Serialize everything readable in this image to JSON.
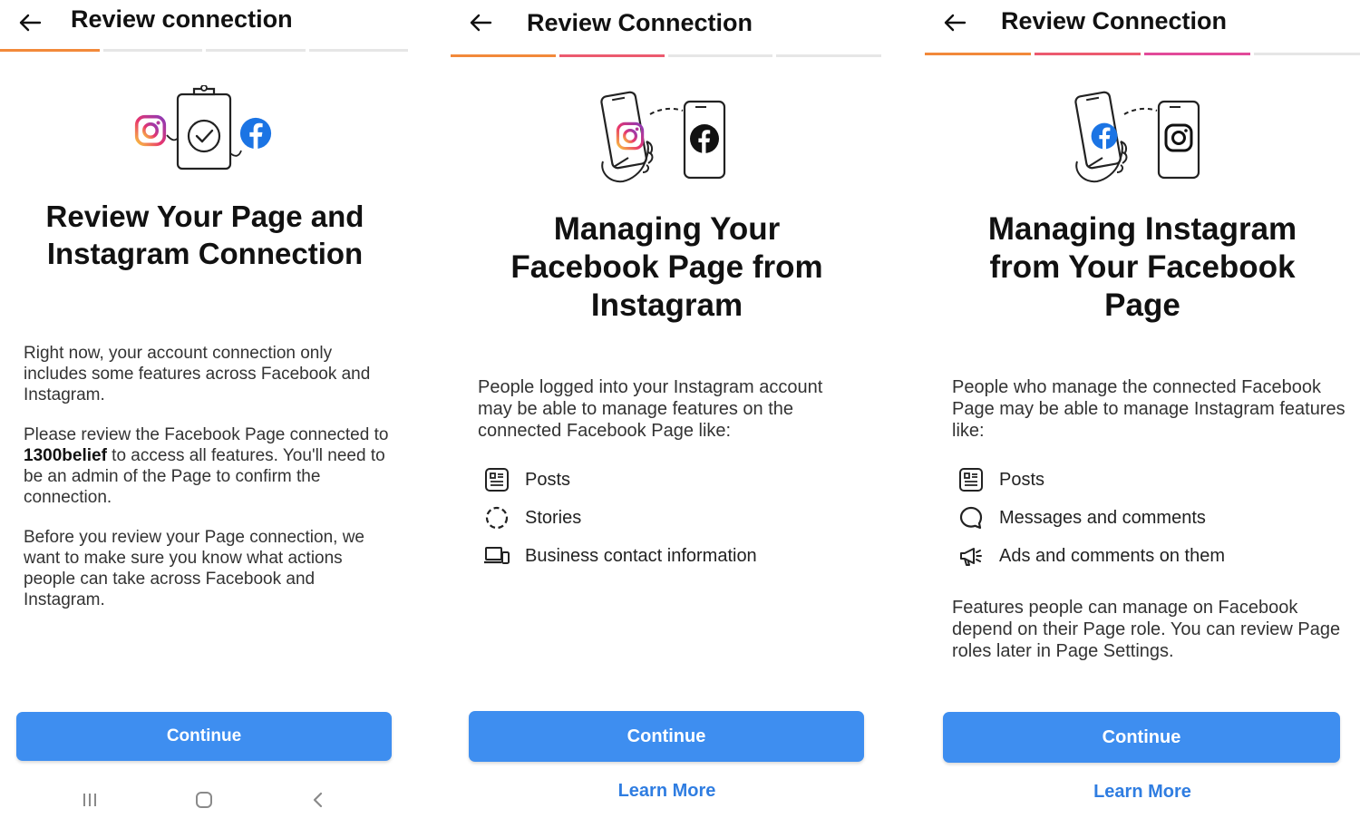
{
  "colors": {
    "accent": "#3e8ef0",
    "link": "#2f7de1",
    "progress_orange": "#f2893a",
    "progress_red": "#ec5a6f",
    "progress_pink": "#e24a9a",
    "progress_gray": "#e6e6e6"
  },
  "panel1": {
    "title": "Review connection",
    "back_icon": "arrow-left-icon",
    "progress_filled": 1,
    "progress_total": 4,
    "heading_line1": "Review Your Page and",
    "heading_line2": "Instagram Connection",
    "para1": "Right now, your account connection only includes some features across Facebook and Instagram.",
    "para2_before": "Please review the Facebook Page connected to ",
    "para2_account": "1300belief",
    "para2_after": " to access all features. You'll need to be an admin of the Page to confirm the connection.",
    "para3": "Before you review your Page connection, we want to make sure you know what actions people can take across Facebook and Instagram.",
    "continue": "Continue",
    "nav_icons": [
      "recent-apps-icon",
      "home-icon",
      "back-chevron-icon"
    ]
  },
  "panel2": {
    "title": "Review Connection",
    "back_icon": "arrow-left-icon",
    "progress_filled": 2,
    "progress_total": 4,
    "heading_line1": "Managing Your",
    "heading_line2": "Facebook Page from",
    "heading_line3": "Instagram",
    "para": "People logged into your Instagram account may be able to manage features on the connected Facebook Page like:",
    "features": [
      {
        "icon": "posts-icon",
        "label": "Posts"
      },
      {
        "icon": "stories-icon",
        "label": "Stories"
      },
      {
        "icon": "contact-info-icon",
        "label": "Business contact information"
      }
    ],
    "continue": "Continue",
    "learn_more": "Learn More"
  },
  "panel3": {
    "title": "Review Connection",
    "back_icon": "arrow-left-icon",
    "progress_filled": 3,
    "progress_total": 4,
    "heading_line1": "Managing Instagram",
    "heading_line2": "from Your Facebook",
    "heading_line3": "Page",
    "para": "People who manage the connected Facebook Page may be able to manage Instagram features like:",
    "features": [
      {
        "icon": "posts-icon",
        "label": "Posts"
      },
      {
        "icon": "messages-icon",
        "label": "Messages and comments"
      },
      {
        "icon": "megaphone-icon",
        "label": "Ads and comments on them"
      }
    ],
    "footnote": "Features people can manage on Facebook depend on their Page role. You can review Page roles later in Page Settings.",
    "continue": "Continue",
    "learn_more": "Learn More"
  }
}
